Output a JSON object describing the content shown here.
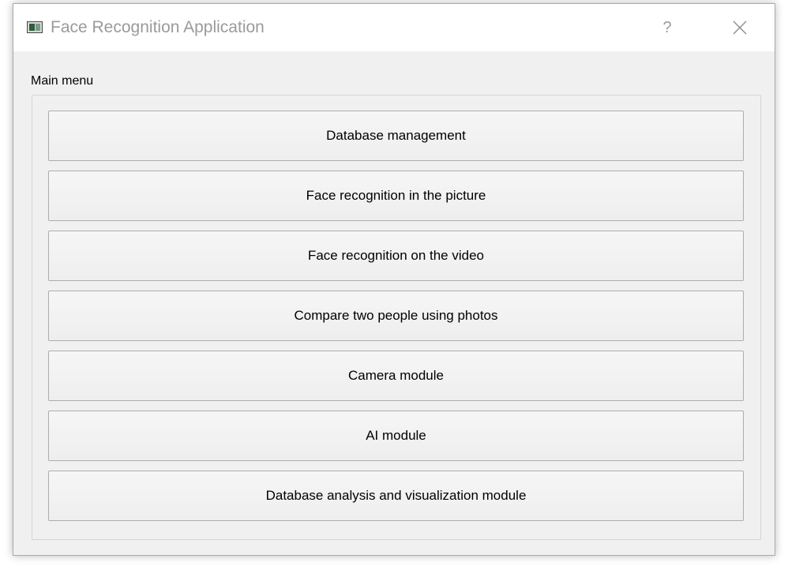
{
  "window": {
    "title": "Face Recognition Application",
    "help_label": "?",
    "app_icon": "application-window-icon",
    "close_icon": "close-icon"
  },
  "main_menu": {
    "label": "Main menu",
    "buttons": [
      {
        "label": "Database management"
      },
      {
        "label": "Face recognition in the picture"
      },
      {
        "label": "Face recognition on the video"
      },
      {
        "label": "Compare two people using photos"
      },
      {
        "label": "Camera module"
      },
      {
        "label": "AI module"
      },
      {
        "label": "Database analysis and visualization module"
      }
    ]
  }
}
